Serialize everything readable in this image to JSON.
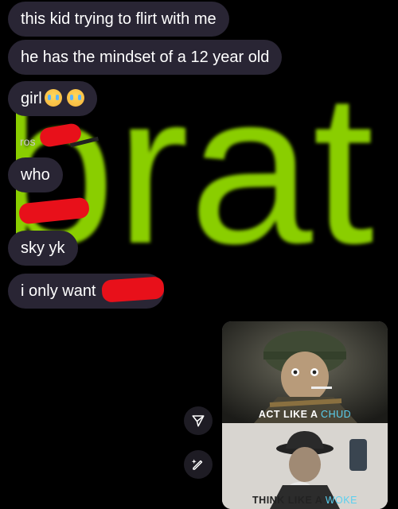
{
  "background_overlay": {
    "word": "brat",
    "color": "#8ace00"
  },
  "messages": [
    {
      "id": "m1",
      "text": "this kid trying to flirt with me"
    },
    {
      "id": "m2",
      "text": "he has the mindset of a 12 year old"
    },
    {
      "id": "m3",
      "text": "girl",
      "emojis": [
        "loudly-crying-face",
        "loudly-crying-face"
      ]
    },
    {
      "id": "m4",
      "text": "who"
    },
    {
      "id": "m5",
      "text": "sky yk"
    },
    {
      "id": "m6",
      "text": "i only want"
    }
  ],
  "partial_labels": {
    "rose": "ros"
  },
  "meme": {
    "top_caption_prefix": "ACT LIKE A",
    "top_caption_accent": "CHUD",
    "bottom_caption_prefix": "THINK LIKE A",
    "bottom_caption_accent": "WOKE"
  },
  "actions": {
    "share_icon": "share-icon",
    "edit_icon": "pencil-sparkle-icon"
  },
  "colors": {
    "bubble": "#292534",
    "redaction": "#e8101a",
    "brat_green": "#8ace00"
  }
}
